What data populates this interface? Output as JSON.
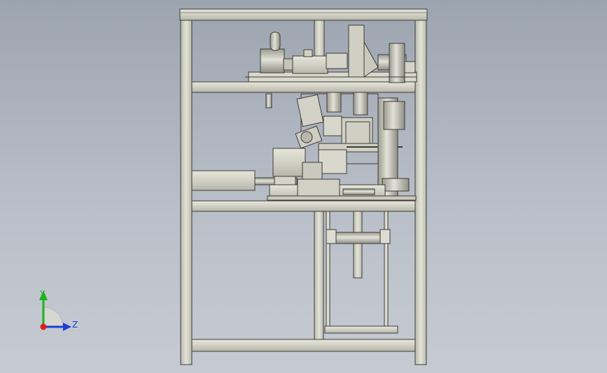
{
  "colors": {
    "background_top": "#9ca4b0",
    "background_bottom": "#c6cbd3",
    "frame_fill": "#d3d3c6",
    "frame_edge": "#3c3c38",
    "part_fill": "#cfcfc4",
    "x_axis": "#e0201a",
    "y_axis": "#1fb21f",
    "z_axis": "#1f3fd6"
  },
  "triad": {
    "y_label": "Y",
    "z_label": "Z"
  }
}
